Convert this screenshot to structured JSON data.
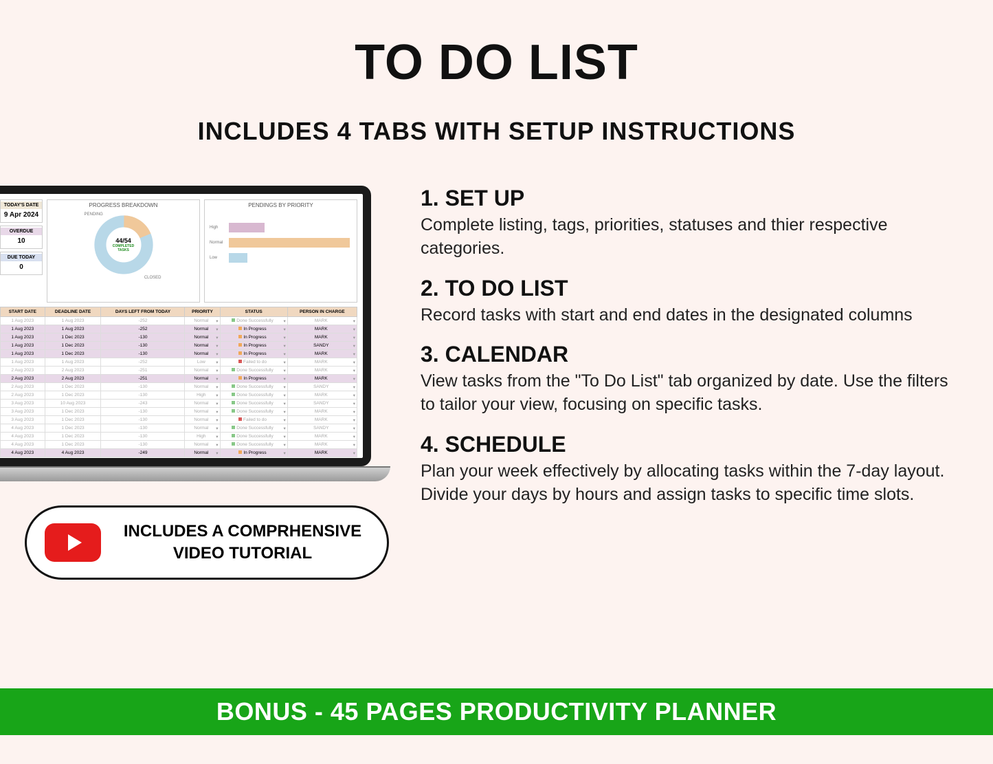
{
  "title": "TO DO LIST",
  "subtitle": "INCLUDES 4 TABS WITH SETUP INSTRUCTIONS",
  "dashboard": {
    "today_label": "TODAY'S DATE",
    "today_value": "9 Apr 2024",
    "overdue_label": "OVERDUE",
    "overdue_value": "10",
    "duetoday_label": "DUE TODAY",
    "duetoday_value": "0",
    "progress_title": "PROGRESS BREAKDOWN",
    "progress_pending_label": "PENDING",
    "progress_closed_label": "CLOSED",
    "progress_center_num": "44/54",
    "progress_center_txt": "COMPLETED TASKS",
    "pendings_title": "PENDINGS BY PRIORITY",
    "priority_high": "High",
    "priority_normal": "Normal",
    "priority_low": "Low"
  },
  "table_headers": {
    "start": "START DATE",
    "deadline": "DEADLINE DATE",
    "days": "DAYS LEFT FROM TODAY",
    "priority": "PRIORITY",
    "status": "STATUS",
    "person": "PERSON IN CHARGE"
  },
  "table_rows": [
    {
      "start": "1 Aug 2023",
      "deadline": "1 Aug 2023",
      "days": "-252",
      "priority": "Normal",
      "status": "Done Successfully",
      "person": "MARK",
      "active": false,
      "dim": true
    },
    {
      "start": "1 Aug 2023",
      "deadline": "1 Aug 2023",
      "days": "-252",
      "priority": "Normal",
      "status": "In Progress",
      "person": "MARK",
      "active": true,
      "dim": false
    },
    {
      "start": "1 Aug 2023",
      "deadline": "1 Dec 2023",
      "days": "-130",
      "priority": "Normal",
      "status": "In Progress",
      "person": "MARK",
      "active": true,
      "dim": false
    },
    {
      "start": "1 Aug 2023",
      "deadline": "1 Dec 2023",
      "days": "-130",
      "priority": "Normal",
      "status": "In Progress",
      "person": "SANDY",
      "active": true,
      "dim": false
    },
    {
      "start": "1 Aug 2023",
      "deadline": "1 Dec 2023",
      "days": "-130",
      "priority": "Normal",
      "status": "In Progress",
      "person": "MARK",
      "active": true,
      "dim": false
    },
    {
      "start": "1 Aug 2023",
      "deadline": "1 Aug 2023",
      "days": "-252",
      "priority": "Low",
      "status": "Failed to do",
      "person": "MARK",
      "active": false,
      "dim": true
    },
    {
      "start": "2 Aug 2023",
      "deadline": "2 Aug 2023",
      "days": "-251",
      "priority": "Normal",
      "status": "Done Successfully",
      "person": "MARK",
      "active": false,
      "dim": true
    },
    {
      "start": "2 Aug 2023",
      "deadline": "2 Aug 2023",
      "days": "-251",
      "priority": "Normal",
      "status": "In Progress",
      "person": "MARK",
      "active": true,
      "dim": false
    },
    {
      "start": "2 Aug 2023",
      "deadline": "1 Dec 2023",
      "days": "-130",
      "priority": "Normal",
      "status": "Done Successfully",
      "person": "SANDY",
      "active": false,
      "dim": true
    },
    {
      "start": "2 Aug 2023",
      "deadline": "1 Dec 2023",
      "days": "-130",
      "priority": "High",
      "status": "Done Successfully",
      "person": "MARK",
      "active": false,
      "dim": true
    },
    {
      "start": "3 Aug 2023",
      "deadline": "10 Aug 2023",
      "days": "-243",
      "priority": "Normal",
      "status": "Done Successfully",
      "person": "SANDY",
      "active": false,
      "dim": true
    },
    {
      "start": "3 Aug 2023",
      "deadline": "1 Dec 2023",
      "days": "-130",
      "priority": "Normal",
      "status": "Done Successfully",
      "person": "MARK",
      "active": false,
      "dim": true
    },
    {
      "start": "3 Aug 2023",
      "deadline": "1 Dec 2023",
      "days": "-130",
      "priority": "Normal",
      "status": "Failed to do",
      "person": "MARK",
      "active": false,
      "dim": true
    },
    {
      "start": "4 Aug 2023",
      "deadline": "1 Dec 2023",
      "days": "-130",
      "priority": "Normal",
      "status": "Done Successfully",
      "person": "SANDY",
      "active": false,
      "dim": true
    },
    {
      "start": "4 Aug 2023",
      "deadline": "1 Dec 2023",
      "days": "-130",
      "priority": "High",
      "status": "Done Successfully",
      "person": "MARK",
      "active": false,
      "dim": true
    },
    {
      "start": "4 Aug 2023",
      "deadline": "1 Dec 2023",
      "days": "-130",
      "priority": "Normal",
      "status": "Done Successfully",
      "person": "MARK",
      "active": false,
      "dim": true
    },
    {
      "start": "4 Aug 2023",
      "deadline": "4 Aug 2023",
      "days": "-249",
      "priority": "Normal",
      "status": "In Progress",
      "person": "MARK",
      "active": true,
      "dim": false
    }
  ],
  "chart_data": [
    {
      "type": "pie",
      "title": "PROGRESS BREAKDOWN",
      "series": [
        {
          "name": "PENDING",
          "value": 10,
          "pct": 18.5
        },
        {
          "name": "CLOSED",
          "value": 44,
          "pct": 81.5
        }
      ],
      "center_label": "44/54 COMPLETED TASKS"
    },
    {
      "type": "bar",
      "title": "PENDINGS BY PRIORITY",
      "categories": [
        "High",
        "Normal",
        "Low"
      ],
      "values": [
        2,
        7,
        1
      ],
      "xlim": [
        0,
        8
      ]
    }
  ],
  "sections": [
    {
      "title": "1. SET UP",
      "text": "Complete listing, tags, priorities, statuses and thier respective categories."
    },
    {
      "title": "2. TO DO LIST",
      "text": "Record tasks with start and end dates in the designated columns"
    },
    {
      "title": "3. CALENDAR",
      "text": "View tasks from the \"To Do List\" tab organized by date. Use the filters to tailor your view, focusing on specific tasks."
    },
    {
      "title": "4. SCHEDULE",
      "text": "Plan your week effectively by allocating tasks within the 7-day layout. Divide your days by hours and assign tasks to specific time slots."
    }
  ],
  "video_badge": {
    "line1": "INCLUDES A COMPRHENSIVE",
    "line2": "VIDEO TUTORIAL"
  },
  "bonus": "BONUS - 45 PAGES PRODUCTIVITY PLANNER"
}
